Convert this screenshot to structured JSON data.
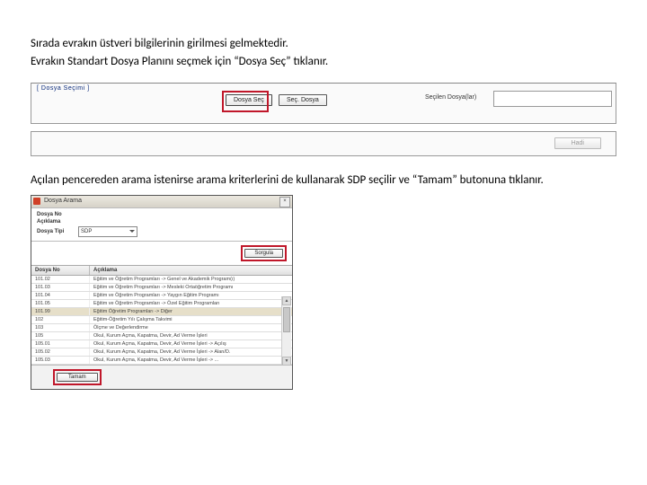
{
  "instr1_a": "Sırada evrakın üstveri bilgilerinin girilmesi gelmektedir.",
  "instr1_b": "Evrakın Standart Dosya Planını seçmek için “Dosya Seç” tıklanır.",
  "shot1": {
    "panel_label": "[ Dosya Seçimi ]",
    "btn_select": "Dosya Seç",
    "btn_remove": "Seç. Dosya",
    "label_selected": "Seçilen Dosya(lar)",
    "footer_btn": "Hadi"
  },
  "instr2": "Açılan pencereden arama istenirse arama kriterlerini de kullanarak SDP seçilir ve “Tamam” butonuna tıklanır.",
  "dialog": {
    "title": "Dosya Arama",
    "close": "×",
    "form": {
      "no": "Dosya No",
      "desc": "Açıklama",
      "type": "Dosya Tipi",
      "type_value": "SDP"
    },
    "btn_query": "Sorgula",
    "btn_ok": "Tamam",
    "grid": {
      "h1": "Dosya No",
      "h2": "Açıklama",
      "rows": [
        {
          "no": "101.02",
          "desc": "Eğitim ve Öğretim Programları -> Genel ve Akademik Program(ı)"
        },
        {
          "no": "101.03",
          "desc": "Eğitim ve Öğretim Programları -> Mesleki Ortaöğretim Programı"
        },
        {
          "no": "101.04",
          "desc": "Eğitim ve Öğretim Programları -> Yaygın Eğitim Programı"
        },
        {
          "no": "101.05",
          "desc": "Eğitim ve Öğretim Programları -> Özel Eğitim Programları"
        },
        {
          "no": "101.99",
          "desc": "Eğitim Öğretim Programları -> Diğer",
          "sel": true
        },
        {
          "no": "102",
          "desc": "Eğitim-Öğretim Yılı Çalışma Takvimi"
        },
        {
          "no": "103",
          "desc": "Ölçme ve Değerlendirme"
        },
        {
          "no": "105",
          "desc": "Okul, Kurum Açma, Kapatma, Devir, Ad Verme İşleri"
        },
        {
          "no": "105.01",
          "desc": "Okul, Kurum Açma, Kapatma, Devir, Ad Verme İşleri -> Açılış"
        },
        {
          "no": "105.02",
          "desc": "Okul, Kurum Açma, Kapatma, Devir, Ad Verme İşleri -> Alan/D."
        },
        {
          "no": "105.03",
          "desc": "Okul, Kurum Açma, Kapatma, Devir, Ad Verme İşleri -> ..."
        }
      ]
    }
  }
}
